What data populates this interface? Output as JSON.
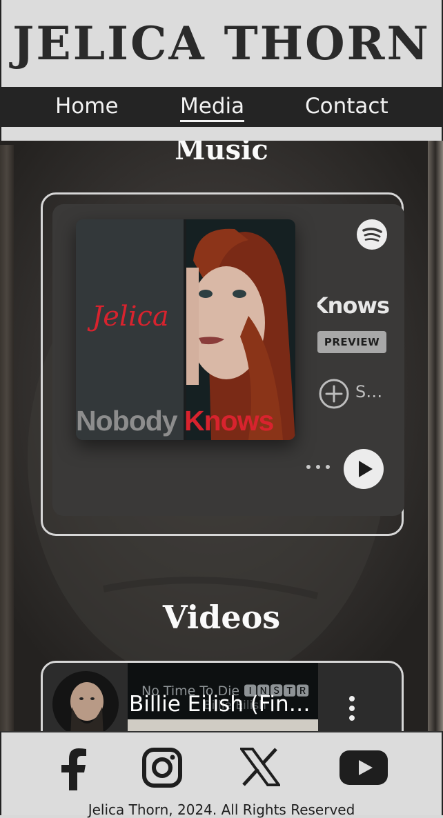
{
  "site": {
    "title": "JELICA THORN"
  },
  "nav": {
    "items": [
      {
        "label": "Home"
      },
      {
        "label": "Media",
        "active": true
      },
      {
        "label": "Contact"
      }
    ]
  },
  "music": {
    "heading": "Music",
    "embed": {
      "cover_script": "Jelica",
      "cover_word1": "Nobody",
      "cover_word2": "Knows",
      "track_name": "Nobody Knows",
      "preview_label": "PREVIEW",
      "save_label": "Save on Spotify",
      "logo_icon": "spotify-icon",
      "play_icon": "play-icon"
    }
  },
  "videos": {
    "heading": "Videos",
    "embed": {
      "thumb_title": "No Time To Die 🅸🅽🆂🆃🆁",
      "thumb_subtitle": "Billie Eilish",
      "title": "Billie Eilish (Final Version)",
      "menu_icon": "more-vert-icon"
    }
  },
  "footer": {
    "icons": [
      "facebook-icon",
      "instagram-icon",
      "x-icon",
      "youtube-icon"
    ],
    "copyright": "Jelica Thorn, 2024. All Rights Reserved"
  },
  "colors": {
    "nav_bg": "#242424",
    "header_bg": "#dcdcdc",
    "accent_red": "#d8232e"
  }
}
